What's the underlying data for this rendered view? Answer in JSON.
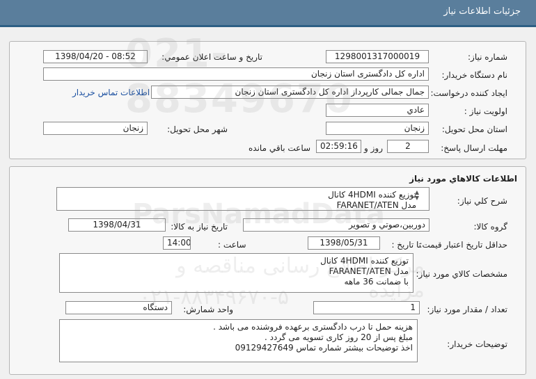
{
  "header": {
    "title": "جزئيات اطلاعات نياز"
  },
  "need": {
    "number_label": "شماره نياز:",
    "number": "1298001317000019",
    "announce_label": "تاريخ و ساعت اعلان عمومي:",
    "announce_value": "1398/04/20 - 08:52",
    "buyer_label": "نام دستگاه خريدار:",
    "buyer": "اداره کل دادگستری استان زنجان",
    "creator_label": "ايجاد کننده درخواست:",
    "creator": "جمال جمالی کارپرداز اداره کل دادگستری استان زنجان",
    "contact_link": "اطلاعات تماس خريدار",
    "priority_label": "اولويت نياز :",
    "priority": "عادي",
    "province_label": "استان محل تحويل:",
    "province": "زنجان",
    "city_label": "شهر محل تحويل:",
    "city": "زنجان",
    "deadline_label": "مهلت ارسال پاسخ:",
    "days": "2",
    "days_word": "روز و",
    "time_left": "02:59:16",
    "time_left_suffix": "ساعت باقي مانده"
  },
  "goods": {
    "section_title": "اطلاعات کالاهاي مورد نياز",
    "summary_label": "شرح کلي نياز:",
    "summary_lines": [
      "توزیع کننده 4HDMI کانال",
      "مدل FARANET/ATEN"
    ],
    "group_label": "گروه کالا:",
    "group": "دوربين،صوتي و تصوير",
    "need_date_label": "تاريخ نياز به کالا:",
    "need_date": "1398/04/31",
    "validity_label": "حداقل تاريخ اعتبار قيمت:",
    "until_label": "تا تاريخ :",
    "validity_date": "1398/05/31",
    "time_label": "ساعت :",
    "validity_time": "14:00",
    "specs_label": "مشخصات کالاي مورد نياز:",
    "specs_lines": [
      "توزیع کننده 4HDMI کانال",
      "مدل FARANET/ATEN",
      "با ضمانت 36 ماهه"
    ],
    "qty_label": "تعداد / مقدار مورد نياز:",
    "qty": "1",
    "unit_label": "واحد شمارش:",
    "unit": "دستگاه",
    "notes_label": "توضيحات خريدار:",
    "notes_lines": [
      "هزینه حمل تا درب دادگستری برعهده فروشنده می باشد .",
      "مبلغ پس از 20 روز کاری تسویه می گردد .",
      "اخذ توضیحات بیشتر شماره تماس 09129427649"
    ]
  },
  "watermark": {
    "line1": "021-88349670",
    "line2": "ParsNamadData",
    "line3": "مرکز اطلاع رسانی مناقصه و مزایده",
    "line4": "۰۲۱-۸۸۳۴۹۶۷۰-۵"
  }
}
